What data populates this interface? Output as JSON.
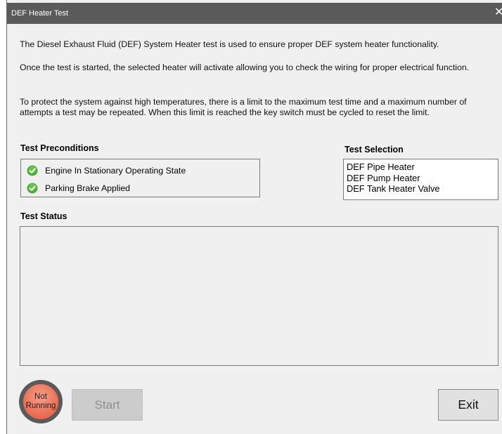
{
  "window": {
    "title": "DEF Heater Test",
    "close_glyph": "✕"
  },
  "description": {
    "paragraph1": "The Diesel Exhaust Fluid (DEF) System Heater test is used to ensure proper DEF system heater functionality.",
    "paragraph2": "Once the test is started, the selected heater will activate allowing you to check the wiring for proper electrical function.",
    "paragraph3": "To protect the system against high temperatures, there is a limit to the maximum test time and a maximum number of attempts a test may be repeated. When this limit is reached the key switch must be cycled to reset the limit."
  },
  "preconditions": {
    "heading": "Test Preconditions",
    "items": [
      {
        "label": "Engine In Stationary Operating State",
        "icon": "check-circle-icon",
        "status_color": "#4caf3a"
      },
      {
        "label": "Parking Brake Applied",
        "icon": "check-circle-icon",
        "status_color": "#4caf3a"
      }
    ]
  },
  "selection": {
    "heading": "Test Selection",
    "options": [
      "DEF Pipe Heater",
      "DEF Pump Heater",
      "DEF Tank Heater Valve"
    ]
  },
  "status": {
    "heading": "Test Status",
    "log": ""
  },
  "footer": {
    "indicator_line1": "Not",
    "indicator_line2": "Running",
    "indicator_color": "#e2553a",
    "start_label": "Start",
    "start_enabled": false,
    "exit_label": "Exit"
  }
}
